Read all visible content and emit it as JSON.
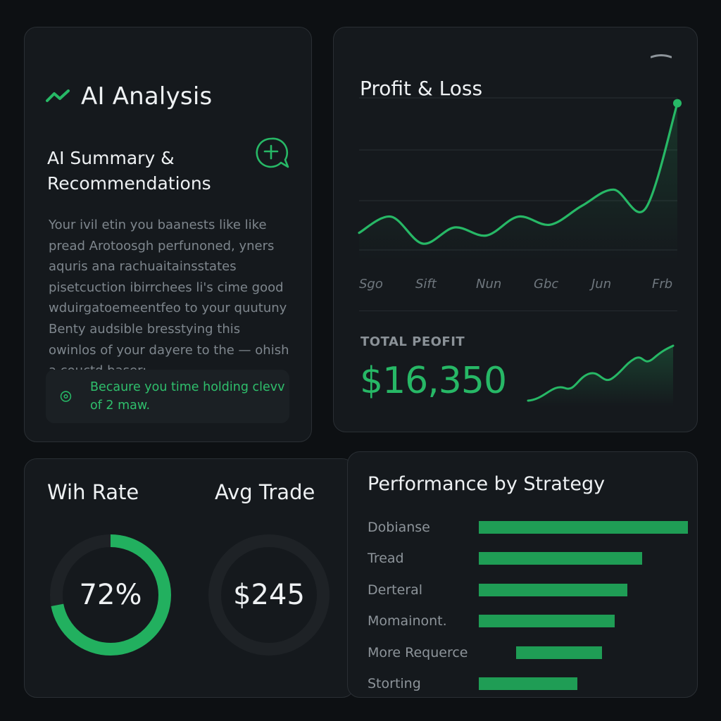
{
  "ai_card": {
    "title": "AI Analysis",
    "subtitle": "AI Summary & Recommendations",
    "body": "Your ivil etin you baanests like like pread Arotoosgh perfunoned, yners aquris ana rachuaitainsstates pisetcuction ibirrchees li's cime good wduirgatoemeentfeo to your quutuny Benty audsible bresstying this owinlos of your dayere to the — ohish a couctd baser:",
    "callout": "Becaure you time holding clevv of 2 maw.",
    "accent": "#27b866"
  },
  "pnl_card": {
    "title": "Profit & Loss",
    "x_ticks": [
      "Sgo",
      "Sift",
      "Nun",
      "Gbc",
      "Jun",
      "Frb"
    ],
    "total_label": "TOTAL PEOFIT",
    "total_value": "$16,350"
  },
  "chart_data": {
    "type": "line",
    "title": "Profit & Loss",
    "categories": [
      "Sgo",
      "Sift",
      "Nun",
      "Gbc",
      "Jun",
      "Frb"
    ],
    "grid": true,
    "series": [
      {
        "x": [
          0,
          0.5,
          1,
          1.5,
          2,
          2.5,
          3,
          3.5,
          4,
          4.5,
          5
        ],
        "values": [
          1.0,
          1.6,
          0.6,
          1.2,
          0.9,
          1.6,
          1.3,
          2.0,
          2.6,
          1.9,
          5.8
        ]
      }
    ]
  },
  "stats": {
    "win_rate_label": "Wih Rate",
    "win_rate_value": "72%",
    "win_rate_fraction": 0.72,
    "avg_trade_label": "Avg Trade",
    "avg_trade_value": "$245"
  },
  "performance": {
    "title": "Performance by Strategy",
    "rows": [
      {
        "label": "Dobianse",
        "start": 0.0,
        "value": 1.0
      },
      {
        "label": "Tread",
        "start": 0.0,
        "value": 0.78
      },
      {
        "label": "Derteral",
        "start": 0.0,
        "value": 0.71
      },
      {
        "label": "Momainont.",
        "start": 0.0,
        "value": 0.65
      },
      {
        "label": "More Requerce",
        "start": 0.18,
        "value": 0.59
      },
      {
        "label": "Storting",
        "start": 0.0,
        "value": 0.47
      }
    ]
  },
  "colors": {
    "green": "#27b866",
    "bar_green": "#1f9d55",
    "background": "#0d1013",
    "card": "#15191d"
  }
}
